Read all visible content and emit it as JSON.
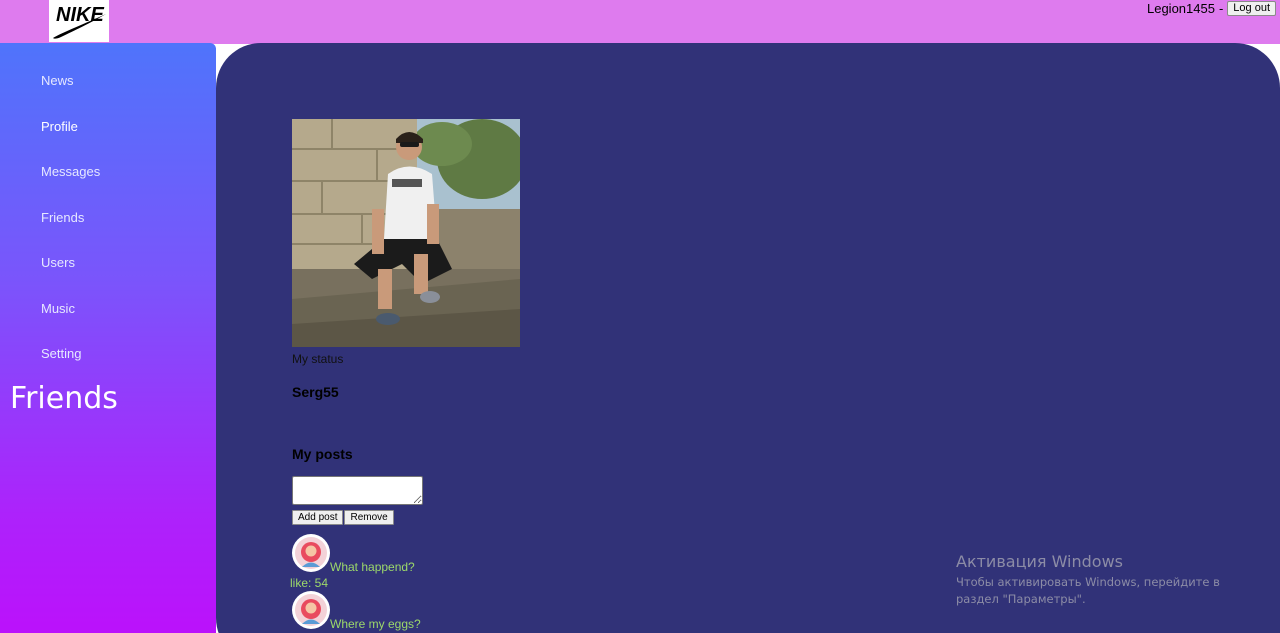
{
  "header": {
    "logo_text": "NIKE",
    "username": "Legion1455",
    "separator": "-",
    "logout_label": "Log out"
  },
  "sidebar": {
    "items": [
      {
        "label": "News",
        "active": false
      },
      {
        "label": "Profile",
        "active": true
      },
      {
        "label": "Messages",
        "active": false
      },
      {
        "label": "Friends",
        "active": false
      },
      {
        "label": "Users",
        "active": false
      },
      {
        "label": "Music",
        "active": false
      },
      {
        "label": "Setting",
        "active": false
      }
    ],
    "friends_title": "Friends"
  },
  "profile": {
    "status": "My status",
    "name": "Serg55"
  },
  "posts": {
    "title": "My posts",
    "input_value": "",
    "add_label": "Add post",
    "remove_label": "Remove",
    "items": [
      {
        "text": "What happend?",
        "like_label": "like: 54"
      },
      {
        "text": "Where my eggs?",
        "like_label": ""
      }
    ]
  },
  "watermark": {
    "title": "Активация Windows",
    "text": "Чтобы активировать Windows, перейдите в раздел \"Параметры\"."
  },
  "colors": {
    "header": "#de7bee",
    "content_bg": "#313278",
    "post_text": "#9cd86a",
    "sidebar_top": "#4f74fb",
    "sidebar_bottom": "#bb11fb"
  }
}
